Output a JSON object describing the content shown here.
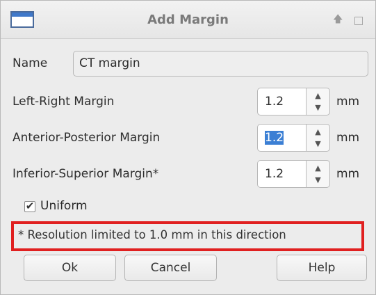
{
  "window": {
    "title": "Add Margin"
  },
  "form": {
    "name_label": "Name",
    "name_value": "CT margin",
    "left_right_label": "Left-Right Margin",
    "left_right_value": "1.2",
    "ant_post_label": "Anterior-Posterior Margin",
    "ant_post_value": "1.2",
    "inf_sup_label": "Inferior-Superior Margin*",
    "inf_sup_value": "1.2",
    "unit": "mm",
    "uniform_label": "Uniform",
    "uniform_checked": true,
    "notice": "* Resolution limited to 1.0 mm in this direction"
  },
  "buttons": {
    "ok": "Ok",
    "cancel": "Cancel",
    "help": "Help"
  },
  "icons": {
    "window": "window-icon",
    "up": "arrow-up-icon",
    "maximize": "maximize-icon",
    "check": "checkmark-icon",
    "spin_up": "chevron-up-icon",
    "spin_down": "chevron-down-icon"
  },
  "colors": {
    "highlight_border": "#e02020",
    "selection": "#3b7fd4"
  }
}
